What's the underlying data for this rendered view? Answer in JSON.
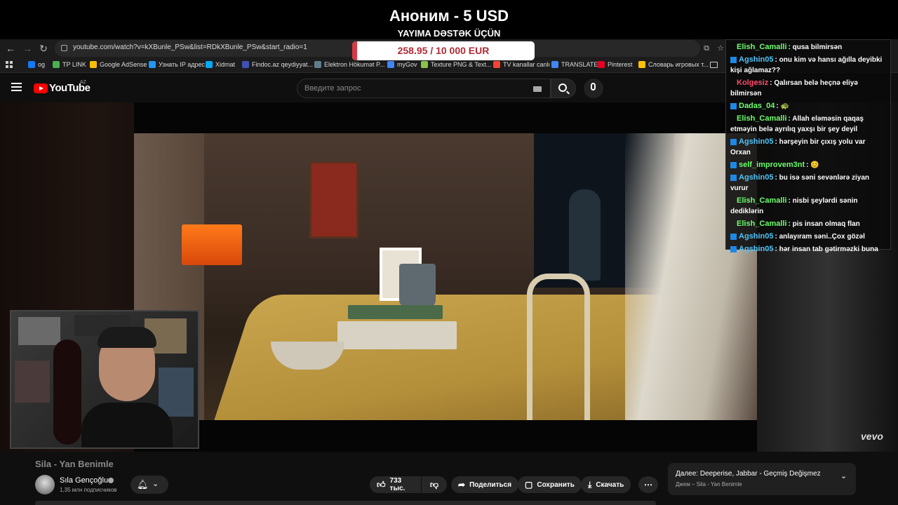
{
  "donation": {
    "title": "Аноним - 5 USD",
    "subtitle": "YAYIMA DƏSTƏK ÜÇÜN",
    "goal_text": "258.95 / 10 000 EUR",
    "goal_progress": 0.026,
    "accent": "#d83a44"
  },
  "browser": {
    "url": "youtube.com/watch?v=kXBunle_PSw&list=RDkXBunle_PSw&start_radio=1",
    "bookmarks": [
      {
        "label": "og",
        "color": "#1877f2"
      },
      {
        "label": "TP LINK",
        "color": "#4caf50"
      },
      {
        "label": "Google AdSense",
        "color": "#fbbc05"
      },
      {
        "label": "Узнать IP адрес",
        "color": "#2196f3"
      },
      {
        "label": "Xidmat",
        "color": "#03a9f4"
      },
      {
        "label": "Findoc.az qeydiyyat...",
        "color": "#3f51b5"
      },
      {
        "label": "Elektron Hökumət P...",
        "color": "#607d8b"
      },
      {
        "label": "myGov",
        "color": "#4285f4"
      },
      {
        "label": "Texture PNG & Text...",
        "color": "#8bc34a"
      },
      {
        "label": "TV kanallar canlı",
        "color": "#f44336"
      },
      {
        "label": "TRANSLATE",
        "color": "#4285f4"
      },
      {
        "label": "Pinterest",
        "color": "#e60023"
      },
      {
        "label": "Словарь игровых т...",
        "color": "#ffc107"
      }
    ]
  },
  "youtube": {
    "logo_text": "YouTube",
    "region": "AZ",
    "search_placeholder": "Введите запрос"
  },
  "chat": [
    {
      "user": "Elish_Camalli",
      "text": ": qusa bilmirsən",
      "color": "#6cff6c",
      "badge": false
    },
    {
      "user": "Agshin05",
      "text": ": onu kim və hansı ağılla deyibki kişi ağlamaz??",
      "color": "#4fc3f7",
      "badge": true
    },
    {
      "user": "Kolgesiz",
      "text": ": Qalırsan belə heçnə eliyə bilmirsən",
      "color": "#ff4d6a",
      "badge": false
    },
    {
      "user": "Dadas_04",
      "text": ": 🐢",
      "color": "#6cff6c",
      "badge": true
    },
    {
      "user": "Elish_Camalli",
      "text": ": Allah eləməsin qaqaş etməyin belə ayrılıq yaxşı bir şey deyil",
      "color": "#6cff6c",
      "badge": false
    },
    {
      "user": "Agshin05",
      "text": ": hərşeyin bir çıxış yolu var Orxan",
      "color": "#4fc3f7",
      "badge": true
    },
    {
      "user": "self_improvem3nt",
      "text": ": 😊",
      "color": "#6cff6c",
      "badge": true
    },
    {
      "user": "Agshin05",
      "text": ": bu isə səni sevənlərə ziyan vurur",
      "color": "#4fc3f7",
      "badge": true
    },
    {
      "user": "Elish_Camalli",
      "text": ": nisbi şeylərdi sənin dediklərin",
      "color": "#6cff6c",
      "badge": false
    },
    {
      "user": "Elish_Camalli",
      "text": ": pis insan olmaq flan",
      "color": "#6cff6c",
      "badge": false
    },
    {
      "user": "Agshin05",
      "text": ": anlayıram səni..Çox gözəl",
      "color": "#4fc3f7",
      "badge": true
    },
    {
      "user": "Agshin05",
      "text": ": hər insan tab gətirməzki buna",
      "color": "#4fc3f7",
      "badge": true
    }
  ],
  "video": {
    "title": "Sila - Yan Benimle",
    "channel": "Sıla Gençoğlu",
    "subscribers": "1,35 млн подписчиков",
    "likes": "733 тыс.",
    "share_label": "Поделиться",
    "save_label": "Сохранить",
    "download_label": "Скачать",
    "watermark": "vevo"
  },
  "next_up": {
    "title": "Далее: Deeperise, Jabbar - Geçmiş Değişmez",
    "subtitle": "Джем – Sila - Yan Benimle"
  }
}
